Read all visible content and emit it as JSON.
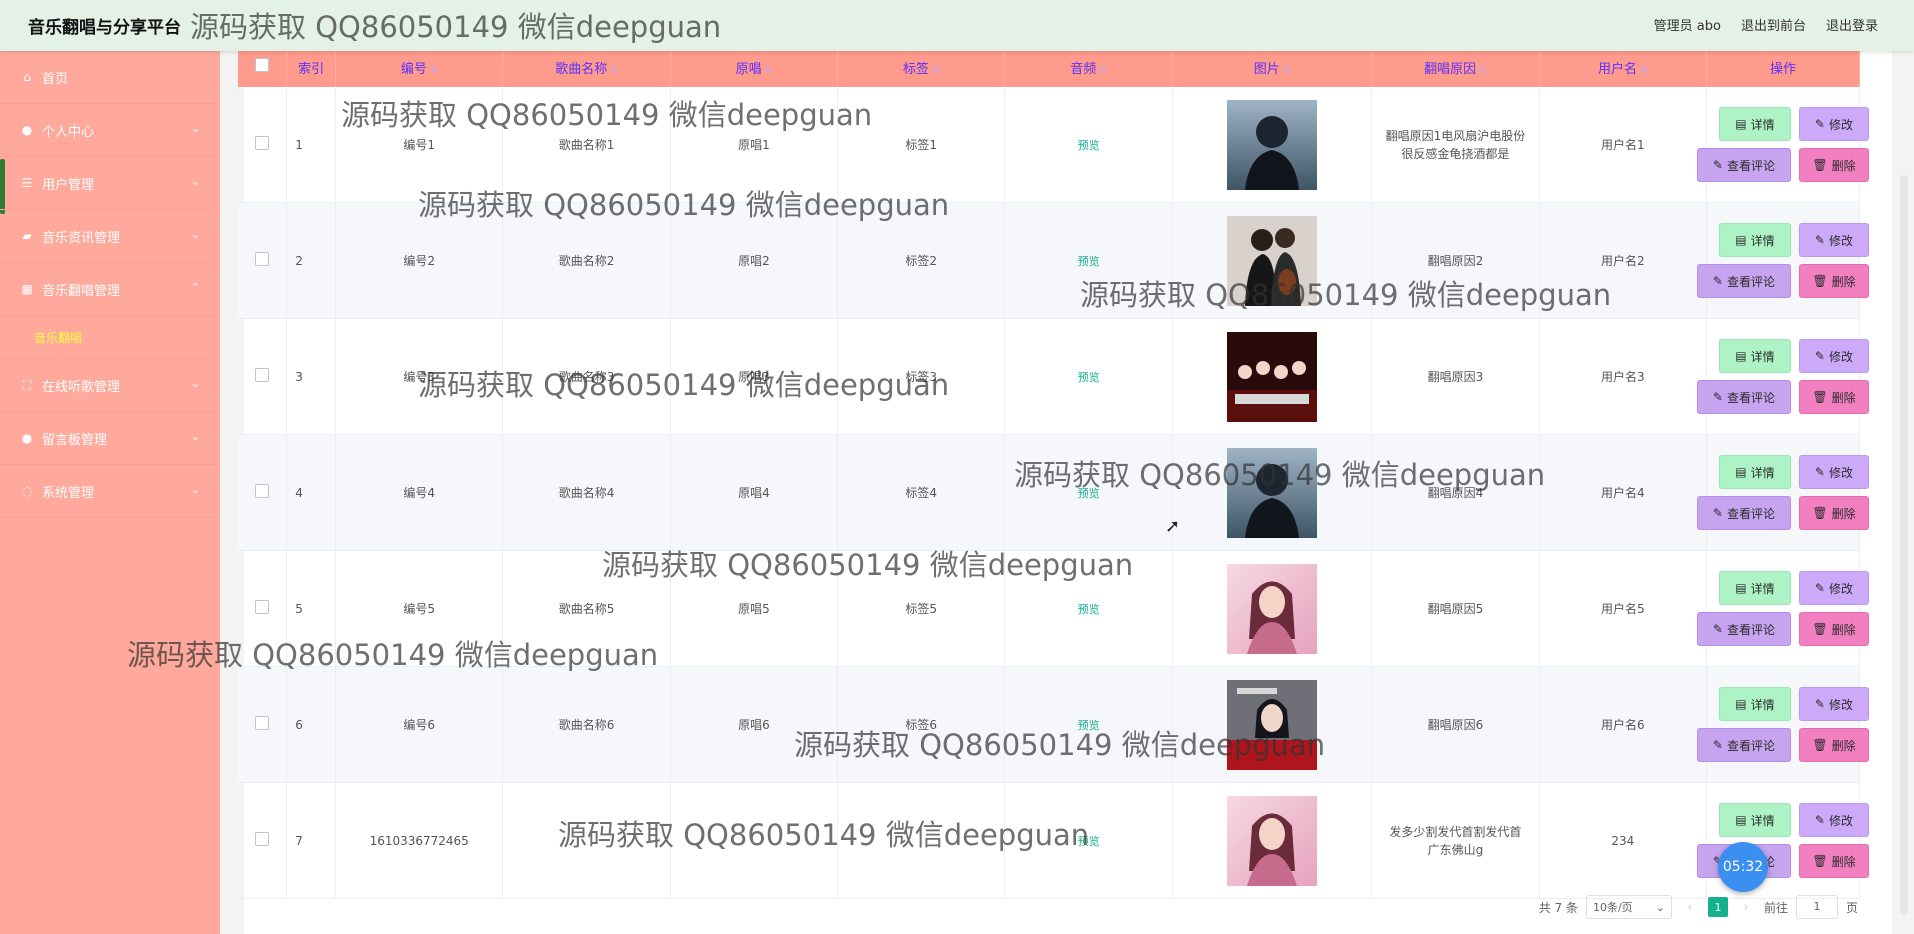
{
  "header": {
    "app_title": "音乐翻唱与分享平台",
    "admin_label": "管理员 abo",
    "front_label": "退出到前台",
    "logout_label": "退出登录"
  },
  "sidebar": {
    "items": [
      {
        "label": "首页",
        "icon": "home-icon",
        "expandable": false
      },
      {
        "label": "个人中心",
        "icon": "person-icon",
        "expandable": true
      },
      {
        "label": "用户管理",
        "icon": "list-icon",
        "expandable": true
      },
      {
        "label": "音乐资讯管理",
        "icon": "ticket-icon",
        "expandable": true
      },
      {
        "label": "音乐翻唱管理",
        "icon": "grid-icon",
        "expandable": true,
        "expanded": true,
        "sub": "音乐翻唱"
      },
      {
        "label": "在线听歌管理",
        "icon": "fullscreen-icon",
        "expandable": true
      },
      {
        "label": "留言板管理",
        "icon": "person-icon",
        "expandable": true
      },
      {
        "label": "系统管理",
        "icon": "globe-icon",
        "expandable": true
      }
    ]
  },
  "table": {
    "columns": [
      "索引",
      "编号",
      "歌曲名称",
      "原唱",
      "标签",
      "音频",
      "图片",
      "翻唱原因",
      "用户名",
      "操作"
    ],
    "preview_label": "预览",
    "rows": [
      {
        "index": "1",
        "code": "编号1",
        "song": "歌曲名称1",
        "original": "原唱1",
        "tag": "标签1",
        "reason": "翻唱原因1电风扇沪电股份很反感金龟挠酒都是",
        "user": "用户名1",
        "image": "dark-male-singer"
      },
      {
        "index": "2",
        "code": "编号2",
        "song": "歌曲名称2",
        "original": "原唱2",
        "tag": "标签2",
        "reason": "翻唱原因2",
        "user": "用户名2",
        "image": "couple-with-guitar"
      },
      {
        "index": "3",
        "code": "编号3",
        "song": "歌曲名称3",
        "original": "原唱3",
        "tag": "标签3",
        "reason": "翻唱原因3",
        "user": "用户名3",
        "image": "band-on-stage"
      },
      {
        "index": "4",
        "code": "编号4",
        "song": "歌曲名称4",
        "original": "原唱4",
        "tag": "标签4",
        "reason": "翻唱原因4",
        "user": "用户名4",
        "image": "dark-male-singer"
      },
      {
        "index": "5",
        "code": "编号5",
        "song": "歌曲名称5",
        "original": "原唱5",
        "tag": "标签5",
        "reason": "翻唱原因5",
        "user": "用户名5",
        "image": "pink-female-singer"
      },
      {
        "index": "6",
        "code": "编号6",
        "song": "歌曲名称6",
        "original": "原唱6",
        "tag": "标签6",
        "reason": "翻唱原因6",
        "user": "用户名6",
        "image": "album-cover-red"
      },
      {
        "index": "7",
        "code": "1610336772465",
        "song": "",
        "original": "",
        "tag": "",
        "reason": "发多少割发代首割发代首广东佛山g",
        "user": "234",
        "image": "pink-female-singer"
      }
    ]
  },
  "actions": {
    "detail": "详情",
    "edit": "修改",
    "comments": "查看评论",
    "delete": "删除"
  },
  "pagination": {
    "total": "共 7 条",
    "page_size": "10条/页",
    "current": "1",
    "goto_prefix": "前往",
    "goto_value": "1",
    "goto_suffix": "页"
  },
  "timer": "05:32",
  "watermark": "源码获取 QQ86050149 微信deepguan",
  "colors": {
    "sidebar": "#ffa99c",
    "header_row": "#ff9b8c",
    "topbar": "#e3f1e6",
    "accent": "#13b28c"
  }
}
